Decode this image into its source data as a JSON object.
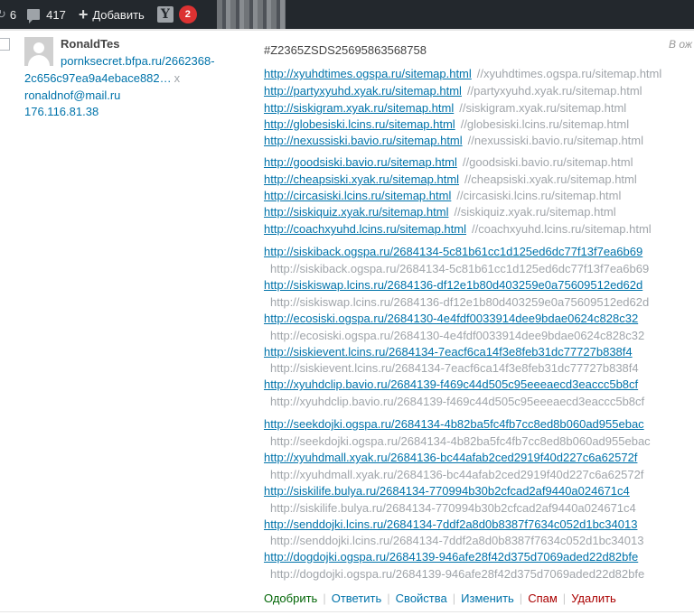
{
  "adminbar": {
    "updates_count": "6",
    "comments_count": "417",
    "new_label": "Добавить",
    "yoast_logo": "Y",
    "yoast_count": "2"
  },
  "comment": {
    "author": {
      "name": "RonaldTes",
      "url_line1": "pornksecret.bfpa.ru/2662368-",
      "url_line2": "2c656c97ea9a4ebace882…",
      "url_remove": "x",
      "email": "ronaldnof@mail.ru",
      "ip": "176.116.81.38"
    },
    "in_reply_to": "В ож",
    "id_text": "#Z2365ZSDS25695863568758",
    "group1": [
      {
        "link": "http://xyuhdtimes.ogspa.ru/sitemap.html",
        "plain": "//xyuhdtimes.ogspa.ru/sitemap.html"
      },
      {
        "link": "http://partyxyuhd.xyak.ru/sitemap.html",
        "plain": "//partyxyuhd.xyak.ru/sitemap.html"
      },
      {
        "link": "http://siskigram.xyak.ru/sitemap.html",
        "plain": "//siskigram.xyak.ru/sitemap.html"
      },
      {
        "link": "http://globesiski.lcins.ru/sitemap.html",
        "plain": "//globesiski.lcins.ru/sitemap.html"
      },
      {
        "link": "http://nexussiski.bavio.ru/sitemap.html",
        "plain": "//nexussiski.bavio.ru/sitemap.html"
      }
    ],
    "group2": [
      {
        "link": "http://goodsiski.bavio.ru/sitemap.html",
        "plain": "//goodsiski.bavio.ru/sitemap.html"
      },
      {
        "link": "http://cheapsiski.xyak.ru/sitemap.html",
        "plain": "//cheapsiski.xyak.ru/sitemap.html"
      },
      {
        "link": "http://circasiski.lcins.ru/sitemap.html",
        "plain": "//circasiski.lcins.ru/sitemap.html"
      },
      {
        "link": "http://siskiquiz.xyak.ru/sitemap.html",
        "plain": "//siskiquiz.xyak.ru/sitemap.html"
      },
      {
        "link": "http://coachxyuhd.lcins.ru/sitemap.html",
        "plain": "//coachxyuhd.lcins.ru/sitemap.html"
      }
    ],
    "group3": [
      {
        "link": "http://siskiback.ogspa.ru/2684134-5c81b61cc1d125ed6dc77f13f7ea6b69",
        "plain": "http://siskiback.ogspa.ru/2684134-5c81b61cc1d125ed6dc77f13f7ea6b69"
      },
      {
        "link": "http://siskiswap.lcins.ru/2684136-df12e1b80d403259e0a75609512ed62d",
        "plain": "http://siskiswap.lcins.ru/2684136-df12e1b80d403259e0a75609512ed62d"
      },
      {
        "link": "http://ecosiski.ogspa.ru/2684130-4e4fdf0033914dee9bdae0624c828c32",
        "plain": "http://ecosiski.ogspa.ru/2684130-4e4fdf0033914dee9bdae0624c828c32"
      },
      {
        "link": "http://siskievent.lcins.ru/2684134-7eacf6ca14f3e8feb31dc77727b838f4",
        "plain": "http://siskievent.lcins.ru/2684134-7eacf6ca14f3e8feb31dc77727b838f4"
      },
      {
        "link": "http://xyuhdclip.bavio.ru/2684139-f469c44d505c95eeeaecd3eaccc5b8cf",
        "plain": "http://xyuhdclip.bavio.ru/2684139-f469c44d505c95eeeaecd3eaccc5b8cf"
      }
    ],
    "group4": [
      {
        "link": "http://seekdojki.ogspa.ru/2684134-4b82ba5fc4fb7cc8ed8b060ad955ebac",
        "plain": "http://seekdojki.ogspa.ru/2684134-4b82ba5fc4fb7cc8ed8b060ad955ebac"
      },
      {
        "link": "http://xyuhdmall.xyak.ru/2684136-bc44afab2ced2919f40d227c6a62572f",
        "plain": "http://xyuhdmall.xyak.ru/2684136-bc44afab2ced2919f40d227c6a62572f"
      },
      {
        "link": "http://siskilife.bulya.ru/2684134-770994b30b2cfcad2af9440a024671c4",
        "plain": "http://siskilife.bulya.ru/2684134-770994b30b2cfcad2af9440a024671c4"
      },
      {
        "link": "http://senddojki.lcins.ru/2684134-7ddf2a8d0b8387f7634c052d1bc34013",
        "plain": "http://senddojki.lcins.ru/2684134-7ddf2a8d0b8387f7634c052d1bc34013"
      },
      {
        "link": "http://dogdojki.ogspa.ru/2684139-946afe28f42d375d7069aded22d82bfe",
        "plain": "http://dogdojki.ogspa.ru/2684139-946afe28f42d375d7069aded22d82bfe"
      }
    ],
    "actions": {
      "approve": "Одобрить",
      "reply": "Ответить",
      "properties": "Свойства",
      "edit": "Изменить",
      "spam": "Спам",
      "delete": "Удалить"
    }
  },
  "colors": {
    "adminbar_bg": "#23282d",
    "link": "#0073aa",
    "approve": "#006505",
    "danger": "#a00",
    "badge": "#dc3232"
  }
}
